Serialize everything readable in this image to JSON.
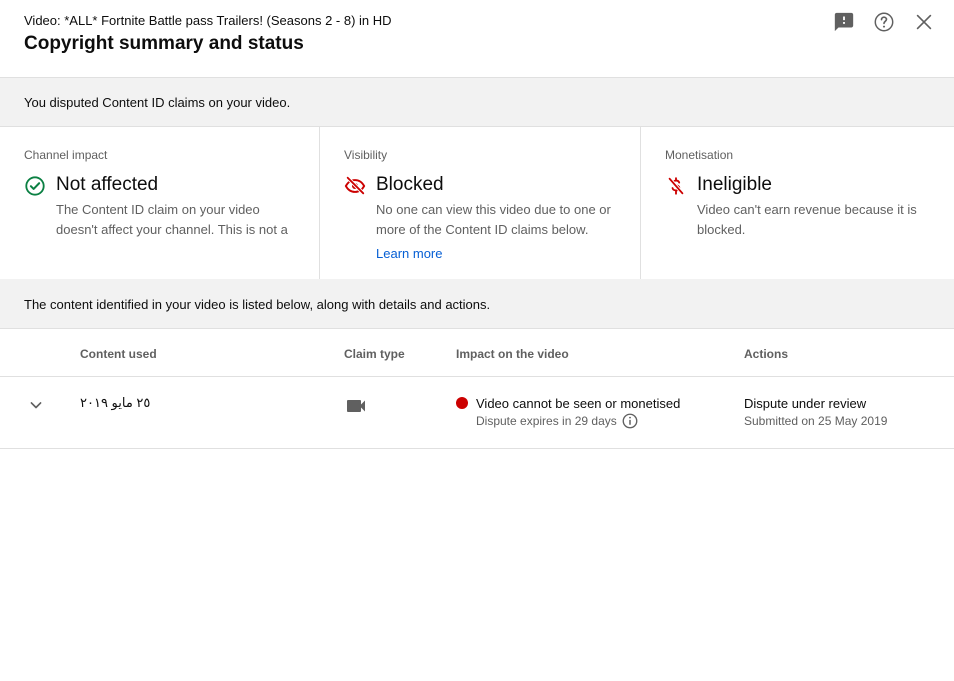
{
  "header": {
    "video_title": "Video: *ALL* Fortnite Battle pass Trailers! (Seasons 2 - 8) in HD",
    "dialog_title": "Copyright summary and status",
    "icons": [
      "feedback-icon",
      "help-icon",
      "close-icon"
    ]
  },
  "banner_disputed": "You disputed Content ID claims on your video.",
  "cards": [
    {
      "label": "Channel impact",
      "status": "Not affected",
      "icon": "check-circle-icon",
      "icon_color": "#0b8043",
      "description": "The Content ID claim on your video doesn't affect your channel. This is not a"
    },
    {
      "label": "Visibility",
      "status": "Blocked",
      "icon": "eye-off-icon",
      "icon_color": "#cc0000",
      "description": "No one can view this video due to one or more of the Content ID claims below.",
      "link": "Learn more"
    },
    {
      "label": "Monetisation",
      "status": "Ineligible",
      "icon": "money-off-icon",
      "icon_color": "#cc0000",
      "description": "Video can't earn revenue because it is blocked."
    }
  ],
  "banner_content": "The content identified in your video is listed below, along with details and actions.",
  "table": {
    "columns": [
      "Content used",
      "Claim type",
      "Impact on the video",
      "Actions"
    ],
    "rows": [
      {
        "content_used": "٢٥ مايو ٢٠١٩",
        "claim_type_icon": "video-camera-icon",
        "impact": "Video cannot be seen or monetised",
        "impact_color": "#cc0000",
        "impact_sub": "Dispute expires in 29 days",
        "action": "Dispute under review",
        "action_sub": "Submitted on 25 May 2019"
      }
    ]
  },
  "colors": {
    "link": "#065fd4",
    "banner_bg": "#f2f2f2",
    "secondary_text": "#606060"
  }
}
